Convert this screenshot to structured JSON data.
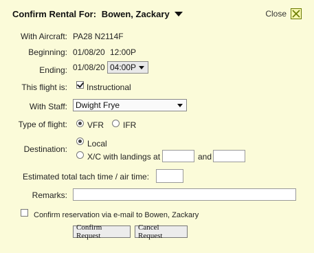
{
  "dialog": {
    "title_prefix": "Confirm Rental For:",
    "renter_name": "Bowen, Zackary",
    "close_label": "Close"
  },
  "aircraft": {
    "label": "With Aircraft:",
    "value": "PA28 N2114F"
  },
  "beginning": {
    "label": "Beginning:",
    "date": "01/08/20",
    "time": "12:00P"
  },
  "ending": {
    "label": "Ending:",
    "date": "01/08/20",
    "time": "04:00P"
  },
  "flight_is": {
    "label": "This flight is:",
    "checkbox_label": "Instructional",
    "checked": true
  },
  "staff": {
    "label": "With Staff:",
    "selected": "Dwight Frye"
  },
  "flight_type": {
    "label": "Type of flight:",
    "options": [
      {
        "label": "VFR",
        "selected": true
      },
      {
        "label": "IFR",
        "selected": false
      }
    ]
  },
  "destination": {
    "label": "Destination:",
    "local_label": "Local",
    "xc_label": "X/C with landings at",
    "and_label": "and",
    "local_selected": true
  },
  "tach": {
    "label": "Estimated total tach time / air time:"
  },
  "remarks": {
    "label": "Remarks:"
  },
  "email": {
    "label": "Confirm reservation via e-mail to Bowen, Zackary",
    "checked": false
  },
  "buttons": {
    "confirm": "Confirm Request",
    "cancel": "Cancel Request"
  }
}
